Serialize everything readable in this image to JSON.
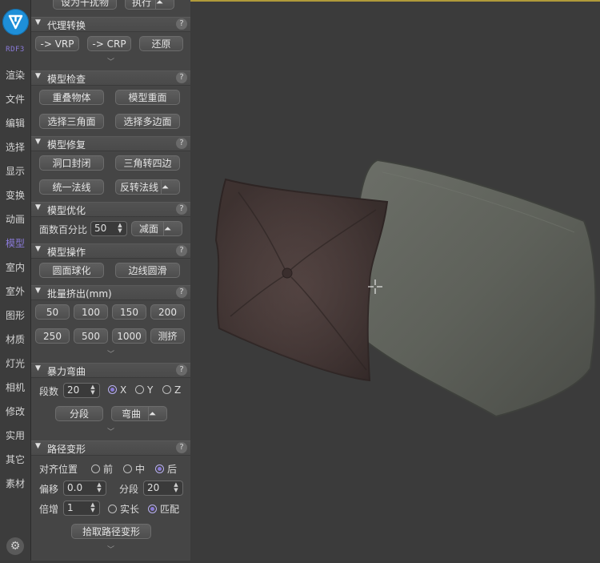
{
  "sidebar": {
    "brand": "RDF3",
    "items": [
      "渲染",
      "文件",
      "编辑",
      "选择",
      "显示",
      "变换",
      "动画",
      "模型",
      "室内",
      "室外",
      "图形",
      "材质",
      "灯光",
      "相机",
      "修改",
      "实用",
      "其它",
      "素材"
    ],
    "active": "模型"
  },
  "top_partial": {
    "set_interference": "设为干扰物",
    "execute": "执行"
  },
  "proxy": {
    "title": "代理转换",
    "to_vrp": "-> VRP",
    "to_crp": "-> CRP",
    "restore": "还原"
  },
  "check": {
    "title": "模型检查",
    "overlap": "重叠物体",
    "dup_face": "模型重面",
    "sel_tri": "选择三角面",
    "sel_poly": "选择多边面"
  },
  "repair": {
    "title": "模型修复",
    "cap_holes": "洞口封闭",
    "tri_to_quad": "三角转四边",
    "unify_normals": "统一法线",
    "flip_normals": "反转法线"
  },
  "optimize": {
    "title": "模型优化",
    "percent_label": "面数百分比",
    "percent_value": "50",
    "reduce": "减面"
  },
  "operate": {
    "title": "模型操作",
    "spherify": "圆面球化",
    "edge_smooth": "边线圆滑"
  },
  "extrude": {
    "title": "批量挤出(mm)",
    "values": [
      "50",
      "100",
      "150",
      "200",
      "250",
      "500",
      "1000"
    ],
    "measure": "测挤"
  },
  "bend": {
    "title": "暴力弯曲",
    "segments_label": "段数",
    "segments_value": "20",
    "axes": [
      "X",
      "Y",
      "Z"
    ],
    "selected_axis": "X",
    "segment_btn": "分段",
    "bend_btn": "弯曲"
  },
  "path": {
    "title": "路径变形",
    "align_label": "对齐位置",
    "align_options": [
      "前",
      "中",
      "后"
    ],
    "align_selected": "后",
    "offset_label": "偏移",
    "offset_value": "0.0",
    "seg_label": "分段",
    "seg_value": "20",
    "mult_label": "倍增",
    "mult_value": "1",
    "fit_options": [
      "实长",
      "匹配"
    ],
    "fit_selected": "匹配",
    "pick_btn": "拾取路径变形"
  },
  "icons": {
    "help": "?",
    "pin": "pin-icon",
    "collapse": "chevron-down-icon",
    "settings": "gear-icon"
  }
}
